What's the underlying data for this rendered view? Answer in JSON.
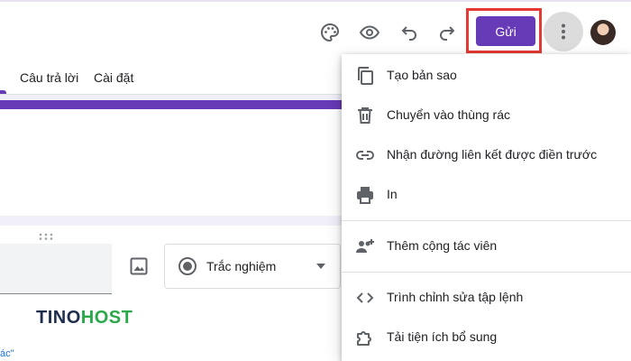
{
  "toolbar": {
    "icons": [
      "palette-icon",
      "preview-eye-icon",
      "undo-icon",
      "redo-icon"
    ],
    "send_label": "Gửi",
    "more_icon": "more-vert-icon"
  },
  "tabs": [
    {
      "label": "Câu trả lời"
    },
    {
      "label": "Cài đặt"
    }
  ],
  "question": {
    "type_label": "Trắc nghiệm"
  },
  "menu": {
    "items": [
      {
        "label": "Tạo bản sao",
        "icon": "copy-icon"
      },
      {
        "label": "Chuyển vào thùng rác",
        "icon": "trash-icon"
      },
      {
        "label": "Nhận đường liên kết được điền trước",
        "icon": "link-icon"
      },
      {
        "label": "In",
        "icon": "print-icon"
      },
      {
        "label": "Thêm cộng tác viên",
        "icon": "add-people-icon"
      },
      {
        "label": "Trình chỉnh sửa tập lệnh",
        "icon": "code-icon"
      },
      {
        "label": "Tải tiện ích bổ sung",
        "icon": "puzzle-icon"
      }
    ]
  },
  "watermark": {
    "part1": "TINO",
    "part2": "HOST"
  },
  "snippet": "ác\"",
  "colors": {
    "accent": "#673ab7",
    "highlight": "#e53935",
    "background": "#f1eff8",
    "watermark_dark": "#1f2e4d",
    "watermark_green": "#2aa84a"
  }
}
